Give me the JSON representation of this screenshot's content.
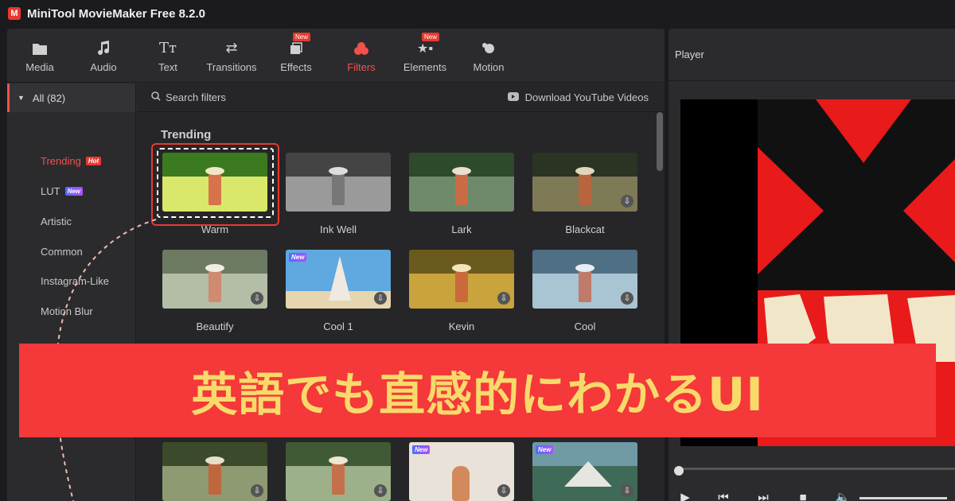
{
  "app": {
    "title": "MiniTool MovieMaker Free 8.2.0",
    "logo_letter": "M"
  },
  "toolbar": {
    "items": [
      {
        "label": "Media",
        "icon": "folder-icon"
      },
      {
        "label": "Audio",
        "icon": "music-note-icon"
      },
      {
        "label": "Text",
        "icon": "text-icon"
      },
      {
        "label": "Transitions",
        "icon": "swap-arrows-icon"
      },
      {
        "label": "Effects",
        "icon": "effects-icon",
        "tag": "New"
      },
      {
        "label": "Filters",
        "icon": "filters-icon",
        "active": true
      },
      {
        "label": "Elements",
        "icon": "elements-icon",
        "tag": "New"
      },
      {
        "label": "Motion",
        "icon": "motion-icon"
      }
    ]
  },
  "sidebar": {
    "all_label": "All (82)",
    "items": [
      {
        "label": "Trending",
        "badge": "Hot",
        "active": true
      },
      {
        "label": "LUT",
        "badge": "New"
      },
      {
        "label": "Artistic"
      },
      {
        "label": "Common"
      },
      {
        "label": "Instagram-Like"
      },
      {
        "label": "Motion Blur"
      }
    ]
  },
  "search": {
    "placeholder": "Search filters",
    "download_label": "Download YouTube Videos"
  },
  "section_title": "Trending",
  "filters": [
    {
      "label": "Warm",
      "selected": true
    },
    {
      "label": "Ink Well"
    },
    {
      "label": "Lark"
    },
    {
      "label": "Blackcat",
      "download": true
    },
    {
      "label": "Beautify",
      "download": true
    },
    {
      "label": "Cool 1",
      "new": true,
      "download": true
    },
    {
      "label": "Kevin",
      "download": true
    },
    {
      "label": "Cool",
      "download": true
    }
  ],
  "player": {
    "title": "Player"
  },
  "badges": {
    "hot": "Hot",
    "new": "New"
  },
  "banner": {
    "text": "英語でも直感的にわかるUI"
  },
  "colors": {
    "accent": "#f0524a",
    "banner_bg": "#f5383a",
    "banner_text": "#f8da6b"
  }
}
